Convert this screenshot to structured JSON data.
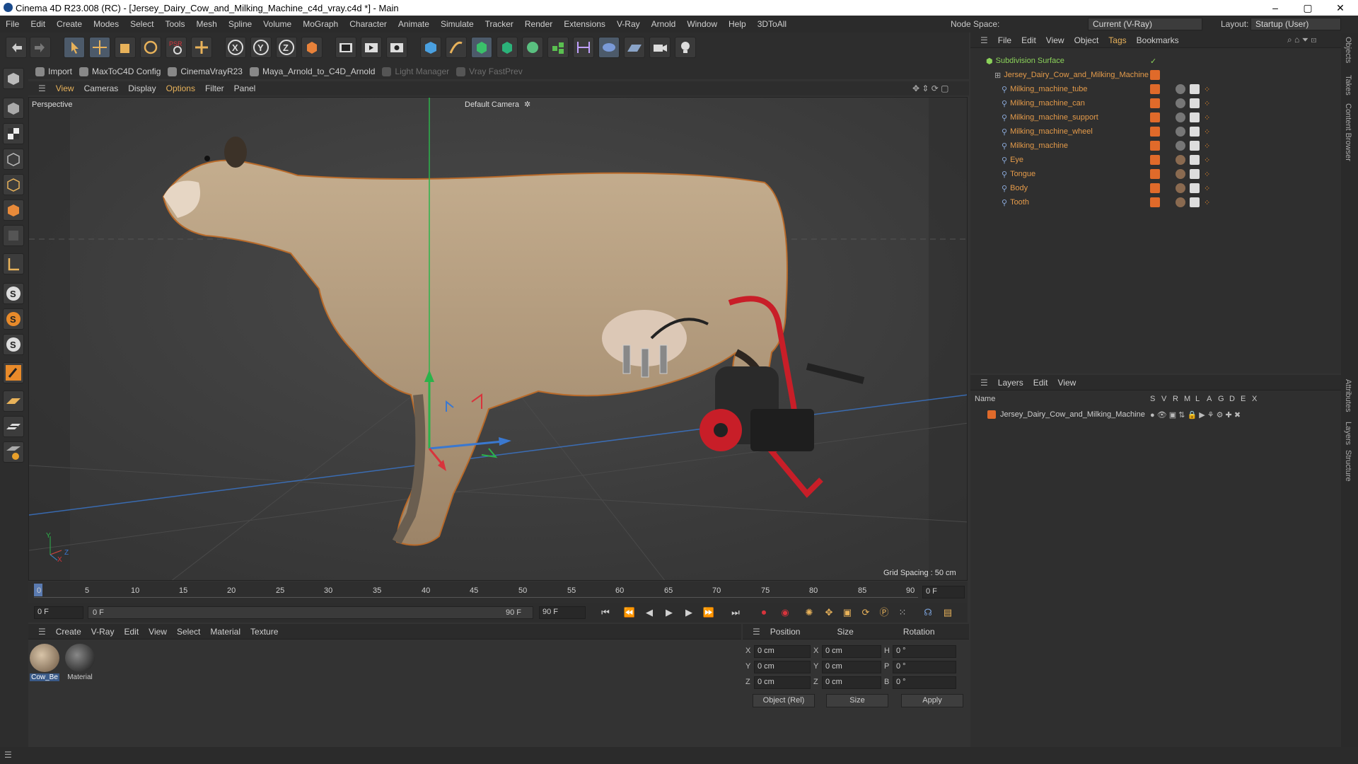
{
  "window": {
    "title": "Cinema 4D R23.008 (RC) - [Jersey_Dairy_Cow_and_Milking_Machine_c4d_vray.c4d *] - Main",
    "minimize": "–",
    "maximize": "▢",
    "close": "✕"
  },
  "menubar": {
    "items": [
      "File",
      "Edit",
      "Create",
      "Modes",
      "Select",
      "Tools",
      "Mesh",
      "Spline",
      "Volume",
      "MoGraph",
      "Character",
      "Animate",
      "Simulate",
      "Tracker",
      "Render",
      "Extensions",
      "V-Ray",
      "Arnold",
      "Window",
      "Help",
      "3DToAll"
    ],
    "node_space_label": "Node Space:",
    "node_space_value": "Current (V-Ray)",
    "layout_label": "Layout:",
    "layout_value": "Startup (User)"
  },
  "plugbar": {
    "items": [
      "Import",
      "MaxToC4D Config",
      "CinemaVrayR23",
      "Maya_Arnold_to_C4D_Arnold",
      "Light Manager",
      "Vray FastPrev"
    ]
  },
  "viewport_menu": {
    "items": [
      "View",
      "Cameras",
      "Display",
      "Options",
      "Filter",
      "Panel"
    ]
  },
  "viewport": {
    "label": "Perspective",
    "camera": "Default Camera",
    "camera_icon": "✲",
    "grid_spacing": "Grid Spacing : 50 cm",
    "axis_y": "Y",
    "axis_x": "X",
    "axis_z": "Z"
  },
  "timeline": {
    "ticks": [
      "0",
      "5",
      "10",
      "15",
      "20",
      "25",
      "30",
      "35",
      "40",
      "45",
      "50",
      "55",
      "60",
      "65",
      "70",
      "75",
      "80",
      "85",
      "90"
    ],
    "current_frame": "0 F"
  },
  "transport": {
    "start_field": "0 F",
    "range_start": "0 F",
    "range_end": "90 F",
    "end_field": "90 F"
  },
  "material_manager": {
    "menu": [
      "Create",
      "V-Ray",
      "Edit",
      "View",
      "Select",
      "Material",
      "Texture"
    ],
    "materials": [
      "Cow_Be",
      "Material"
    ]
  },
  "coords": {
    "headers": [
      "Position",
      "Size",
      "Rotation"
    ],
    "rows": [
      {
        "axis": "X",
        "pos": "0 cm",
        "saxis": "X",
        "size": "0 cm",
        "raxis": "H",
        "rot": "0 °"
      },
      {
        "axis": "Y",
        "pos": "0 cm",
        "saxis": "Y",
        "size": "0 cm",
        "raxis": "P",
        "rot": "0 °"
      },
      {
        "axis": "Z",
        "pos": "0 cm",
        "saxis": "Z",
        "size": "0 cm",
        "raxis": "B",
        "rot": "0 °"
      }
    ],
    "mode": "Object (Rel)",
    "size_mode": "Size",
    "apply": "Apply"
  },
  "object_manager": {
    "menu": [
      "File",
      "Edit",
      "View",
      "Object",
      "Tags",
      "Bookmarks"
    ],
    "root": "Subdivision Surface",
    "group": "Jersey_Dairy_Cow_and_Milking_Machine",
    "children": [
      "Milking_machine_tube",
      "Milking_machine_can",
      "Milking_machine_support",
      "Milking_machine_wheel",
      "Milking_machine",
      "Eye",
      "Tongue",
      "Body",
      "Tooth"
    ]
  },
  "layer_manager": {
    "menu": [
      "Layers",
      "Edit",
      "View"
    ],
    "columns": [
      "Name",
      "S",
      "V",
      "R",
      "M",
      "L",
      "A",
      "G",
      "D",
      "E",
      "X"
    ],
    "layers": [
      "Jersey_Dairy_Cow_and_Milking_Machine"
    ]
  },
  "right_tabs": [
    "Objects",
    "Takes",
    "Content Browser",
    "Attributes",
    "Layers",
    "Structure"
  ],
  "colors": {
    "accent": "#e8b25a",
    "object_name": "#e39a4a",
    "group_green": "#8bd25a",
    "axis_red": "#d8343c",
    "axis_green": "#2bb34a",
    "axis_blue": "#3a78d0"
  }
}
